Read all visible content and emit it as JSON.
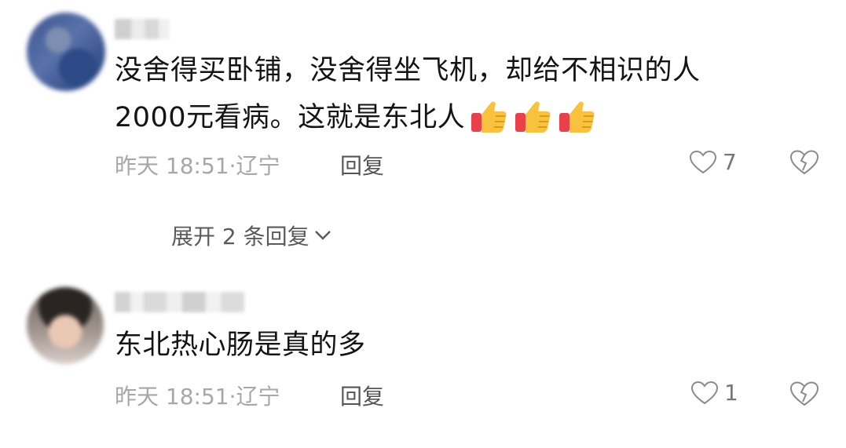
{
  "comments": [
    {
      "text_line1": "没舍得买卧铺，没舍得坐飞机，却给不相识的人",
      "text_line2": "2000元看病。这就是东北人",
      "time": "昨天 18:51",
      "location": "辽宁",
      "reply_label": "回复",
      "likes": "7",
      "emoji": [
        "thumbs-up",
        "thumbs-up",
        "thumbs-up"
      ]
    },
    {
      "text_line1": "东北热心肠是真的多",
      "time": "昨天 18:51",
      "location": "辽宁",
      "reply_label": "回复",
      "likes": "1"
    }
  ],
  "expand_replies": "展开 2 条回复",
  "colors": {
    "text": "#141414",
    "meta": "#a7a7a7",
    "thumb_red": "#e8414b",
    "thumb_yellow": "#f9c23c"
  }
}
